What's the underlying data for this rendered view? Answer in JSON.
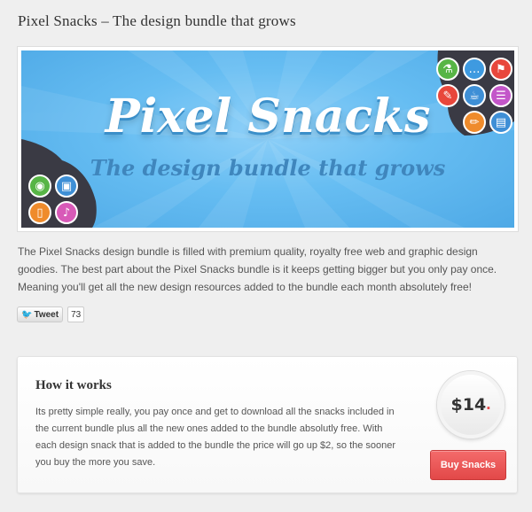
{
  "page": {
    "title": "Pixel Snacks – The design bundle that grows"
  },
  "banner": {
    "title": "Pixel Snacks",
    "subtitle": "The design bundle that grows",
    "icons": [
      "flask-icon",
      "chat-icon",
      "flag-icon",
      "pen-icon",
      "cup-icon",
      "list-icon",
      "pencil-icon",
      "document-icon",
      "camera-icon",
      "image-icon",
      "file-icon",
      "music-icon"
    ]
  },
  "description": "The Pixel Snacks design bundle is filled with premium quality, royalty free web and graphic design goodies. The best part about the Pixel Snacks bundle is it keeps getting bigger but you only pay once. Meaning you'll get all the new design resources added to the bundle each month absolutely free!",
  "tweet": {
    "label": "Tweet",
    "count": "73"
  },
  "how_it_works": {
    "heading": "How it works",
    "text": "Its pretty simple really, you pay once and get to download all the snacks included in the current bundle plus all the new ones added to the bundle absolutly free. With each design snack that is added to the bundle the price will go up $2, so the sooner you buy the more you save.",
    "price": "$14",
    "buy_label": "Buy Snacks"
  },
  "colors": {
    "accent": "#e24848",
    "banner_blue": "#66bdf2"
  }
}
